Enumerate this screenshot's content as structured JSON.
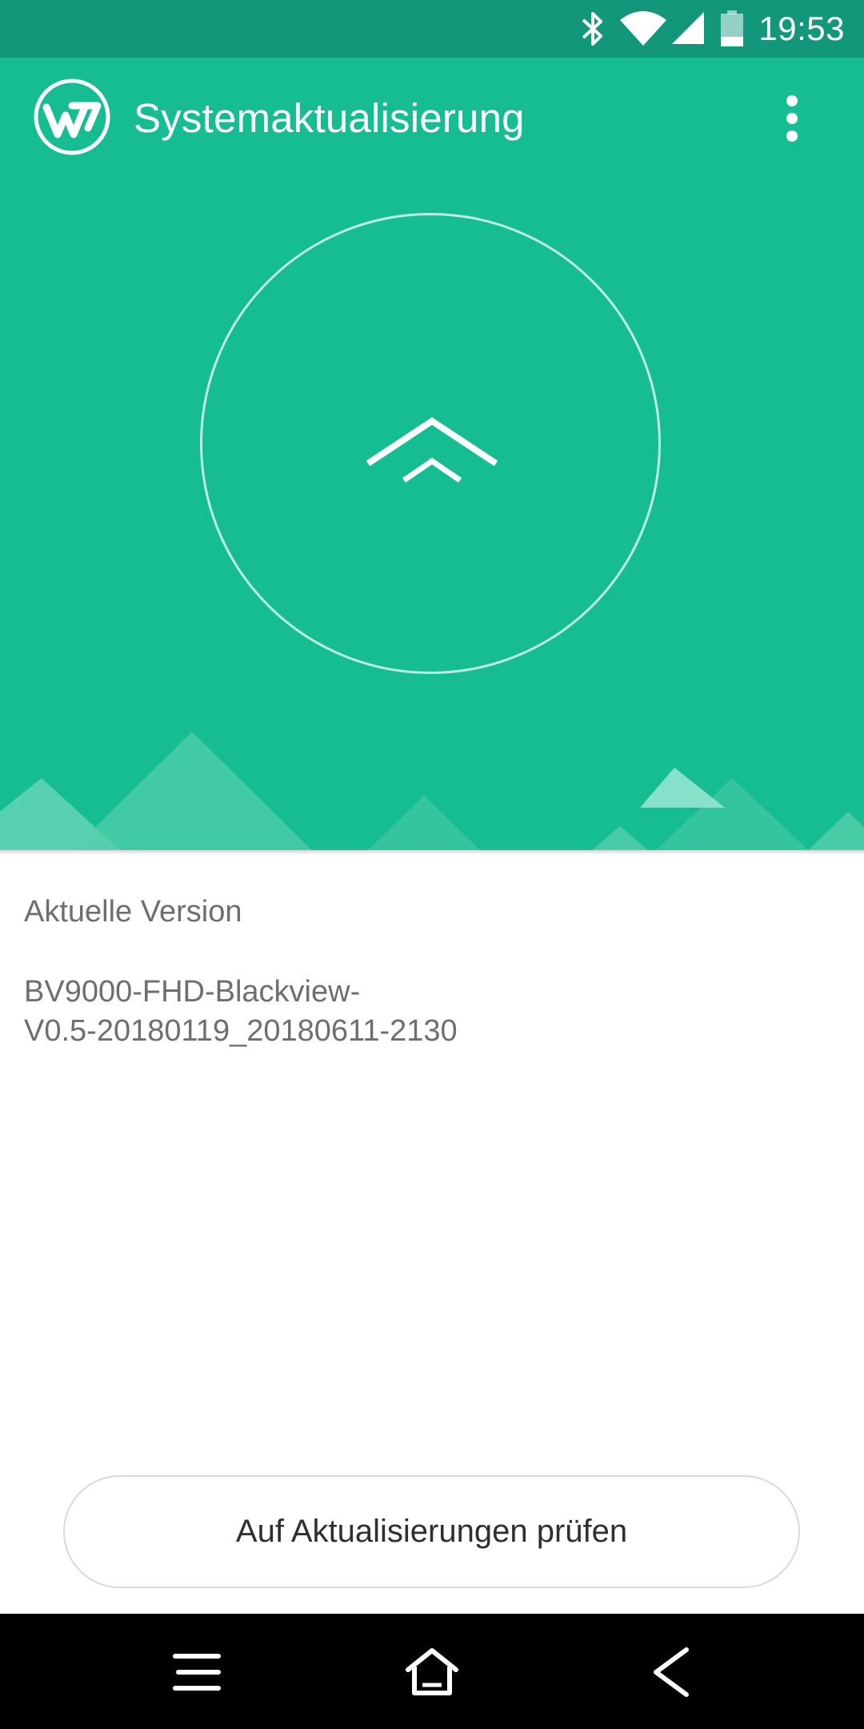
{
  "status_bar": {
    "time": "19:53",
    "icons": [
      "bluetooth-icon",
      "wifi-icon",
      "cellular-signal-icon",
      "battery-icon"
    ]
  },
  "app_bar": {
    "title": "Systemaktualisierung",
    "logo_icon": "app-logo-icon",
    "menu_icon": "more-vert-icon"
  },
  "hero": {
    "icon": "update-arrow-icon"
  },
  "version": {
    "label": "Aktuelle Version",
    "value": "BV9000-FHD-Blackview-\nV0.5-20180119_20180611-2130"
  },
  "actions": {
    "check_label": "Auf Aktualisierungen prüfen"
  },
  "nav_bar": {
    "icons": [
      "menu-icon",
      "home-icon",
      "back-icon"
    ]
  },
  "colors": {
    "primary": "#16bd93",
    "status_bar": "#12977a",
    "text_secondary": "#6e6e6e"
  }
}
